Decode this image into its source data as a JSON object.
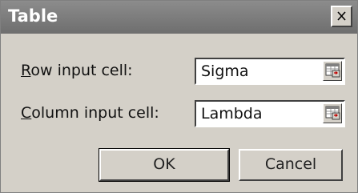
{
  "dialog": {
    "title": "Table",
    "close_icon": "close-icon"
  },
  "fields": {
    "row_label_first": "R",
    "row_label_rest": "ow input cell:",
    "row_value": "Sigma",
    "col_label_first": "C",
    "col_label_rest": "olumn input cell:",
    "col_value": "Lambda",
    "ref_icon": "collapse-dialog-icon"
  },
  "buttons": {
    "ok": "OK",
    "cancel": "Cancel"
  }
}
